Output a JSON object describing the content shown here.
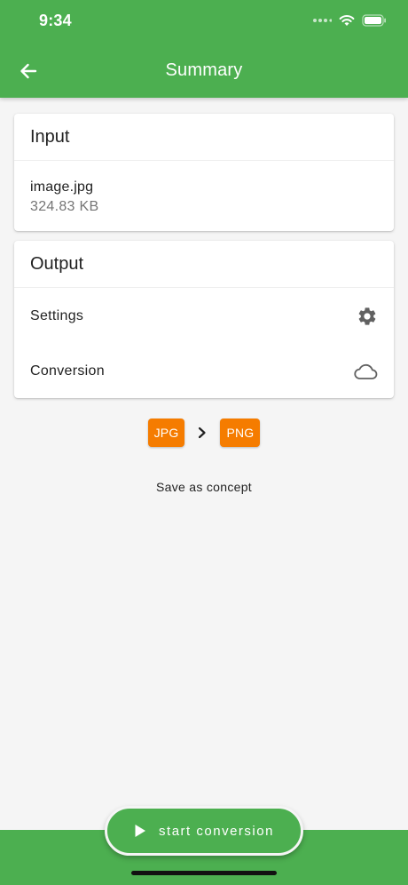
{
  "status_bar": {
    "time": "9:34"
  },
  "app_bar": {
    "title": "Summary",
    "back_icon": "arrow-back-icon"
  },
  "input_card": {
    "header": "Input",
    "file_name": "image.jpg",
    "file_size": "324.83 KB"
  },
  "output_card": {
    "header": "Output",
    "settings_label": "Settings",
    "settings_icon": "gear-icon",
    "conversion_label": "Conversion",
    "conversion_icon": "cloud-icon"
  },
  "conversion": {
    "from": "JPG",
    "to": "PNG",
    "arrow_icon": "chevron-right-icon"
  },
  "save_concept_label": "Save as concept",
  "start_button": {
    "label": "start conversion",
    "icon": "play-icon"
  },
  "colors": {
    "primary": "#4caf50",
    "accent": "#f57c00",
    "background": "#f5f5f5"
  }
}
